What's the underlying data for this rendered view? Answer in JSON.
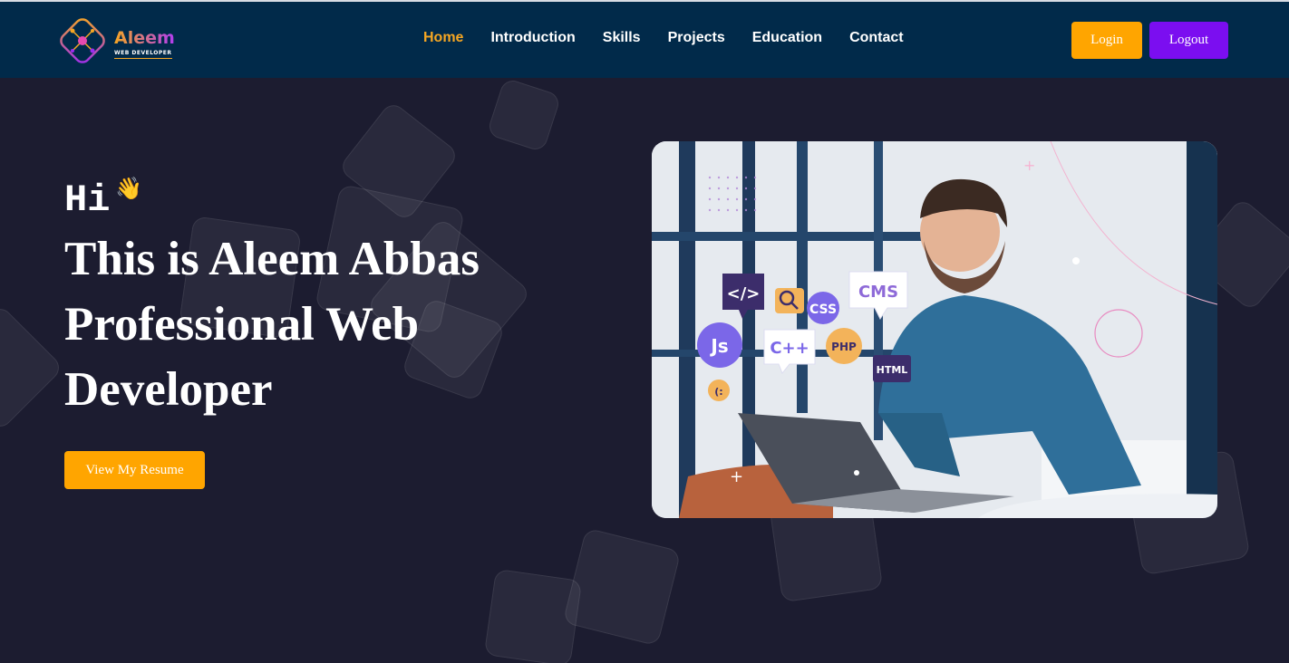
{
  "header": {
    "logo": {
      "name": "Aleem",
      "tagline": "WEB DEVELOPER"
    },
    "nav": [
      {
        "label": "Home",
        "active": true
      },
      {
        "label": "Introduction"
      },
      {
        "label": "Skills"
      },
      {
        "label": "Projects"
      },
      {
        "label": "Education"
      },
      {
        "label": "Contact"
      }
    ],
    "login_label": "Login",
    "logout_label": "Logout"
  },
  "hero": {
    "greeting": "Hi",
    "wave_emoji": "👋",
    "title_lines": [
      "This is Aleem Abbas",
      "Professional Web",
      "Developer"
    ],
    "resume_label": "View My Resume",
    "image_badges": [
      "</>",
      "CSS",
      "CMS",
      "Js",
      "C++",
      "PHP",
      "HTML",
      "(:"
    ]
  },
  "colors": {
    "header_bg": "#012a4a",
    "page_bg": "#1c1c30",
    "accent_orange": "#ffa500",
    "accent_purple": "#7b0ef0"
  }
}
